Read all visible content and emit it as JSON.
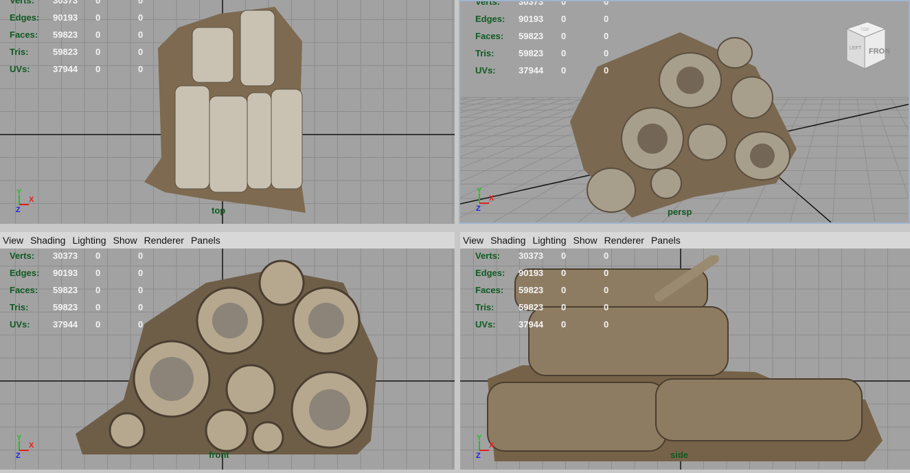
{
  "menu": [
    "View",
    "Shading",
    "Lighting",
    "Show",
    "Renderer",
    "Panels"
  ],
  "stats": [
    {
      "label": "Verts:",
      "value": "30373",
      "sel": "0",
      "comp": "0"
    },
    {
      "label": "Edges:",
      "value": "90193",
      "sel": "0",
      "comp": "0"
    },
    {
      "label": "Faces:",
      "value": "59823",
      "sel": "0",
      "comp": "0"
    },
    {
      "label": "Tris:",
      "value": "59823",
      "sel": "0",
      "comp": "0"
    },
    {
      "label": "UVs:",
      "value": "37944",
      "sel": "0",
      "comp": "0"
    }
  ],
  "views": {
    "top": "top",
    "persp": "persp",
    "front": "front",
    "side": "side"
  },
  "viewcube": {
    "front": "FRONT",
    "left": "LEFT",
    "top": "TOP"
  },
  "axes": {
    "x": "X",
    "y": "Y",
    "z": "Z"
  },
  "colors": {
    "viewport": "#a2a2a2",
    "grid": "#8c8c8c",
    "hud_label": "#0f5a22",
    "axis_x": "#e02020",
    "axis_y": "#20c020",
    "axis_z": "#2020e0"
  }
}
